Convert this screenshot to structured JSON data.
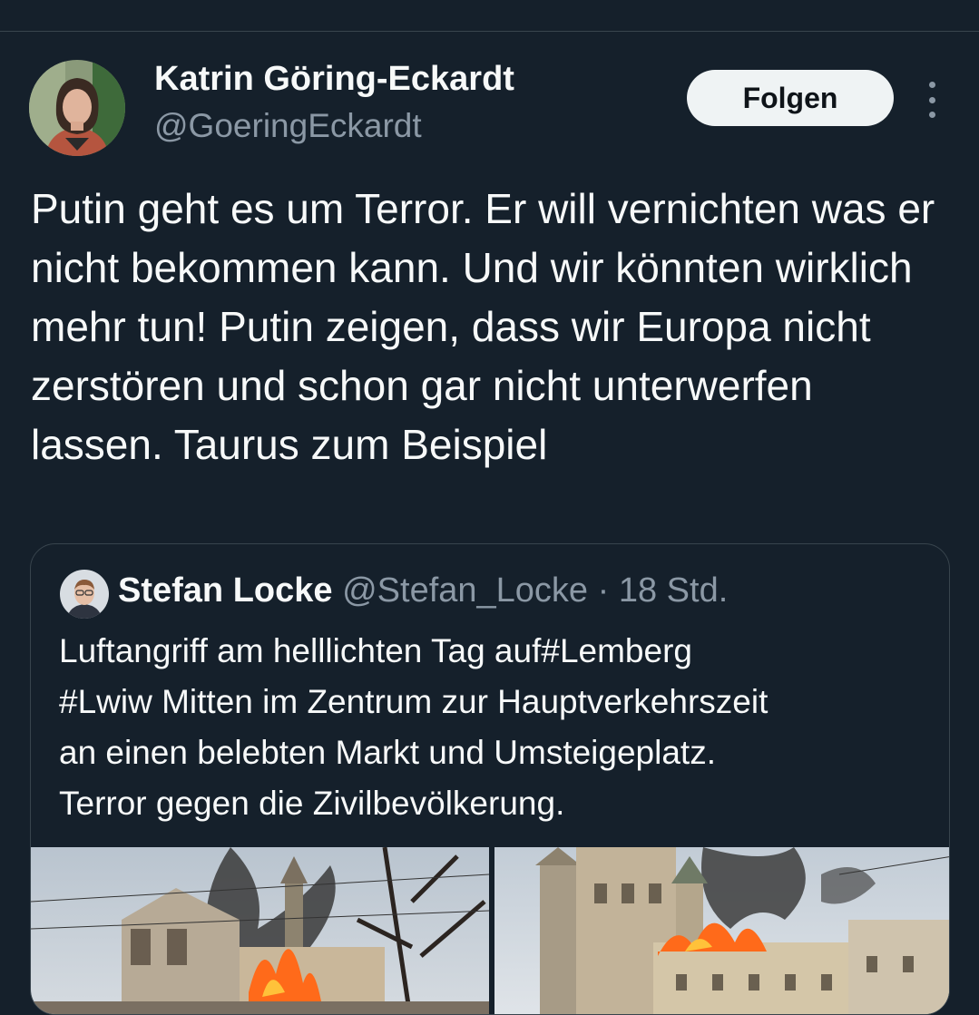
{
  "tweet": {
    "author": {
      "name": "Katrin Göring-Eckardt",
      "handle": "@GoeringEckardt"
    },
    "follow_label": "Folgen",
    "text": "Putin geht es um Terror. Er will vernichten was er nicht bekommen kann. Und wir könnten wirklich mehr tun! Putin zeigen, dass wir Europa nicht zerstören und schon gar nicht unterwerfen lassen. Taurus zum Beispiel"
  },
  "quoted_tweet": {
    "author": {
      "name": "Stefan Locke",
      "handle": "@Stefan_Locke",
      "time": "· 18 Std."
    },
    "text_lines": [
      "Luftangriff am helllichten Tag auf#Lemberg",
      "#Lwiw Mitten im Zentrum zur Hauptverkehrszeit",
      "an einen belebten Markt und Umsteigeplatz.",
      "Terror gegen die Zivilbevölkerung."
    ]
  },
  "icons": {
    "more": "more-vertical-icon"
  },
  "colors": {
    "background": "#15202b",
    "secondary_text": "#8b98a5",
    "border": "#38444d",
    "button_bg": "#eff3f4"
  }
}
